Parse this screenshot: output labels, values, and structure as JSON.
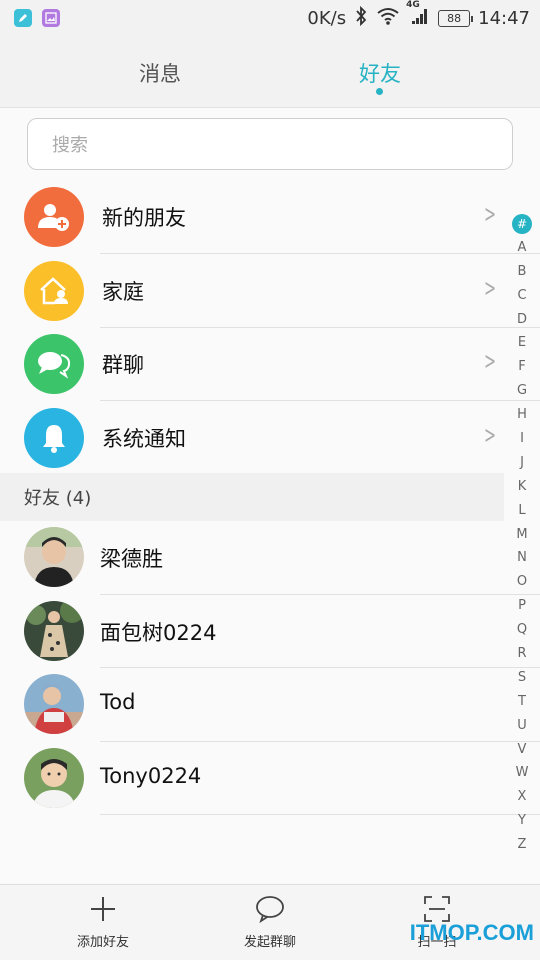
{
  "status_bar": {
    "speed": "0K/s",
    "network": "4G",
    "battery": "88",
    "time": "14:47",
    "icons": [
      "note-app-icon",
      "gallery-app-icon",
      "bluetooth-icon",
      "wifi-icon",
      "signal-icon",
      "battery-icon"
    ]
  },
  "tabs": [
    {
      "label": "消息",
      "active": false
    },
    {
      "label": "好友",
      "active": true
    }
  ],
  "search": {
    "placeholder": "搜索"
  },
  "functions": [
    {
      "label": "新的朋友",
      "icon": "add-user-icon",
      "color": "#f26d3d"
    },
    {
      "label": "家庭",
      "icon": "home-icon",
      "color": "#fbbf2a"
    },
    {
      "label": "群聊",
      "icon": "chat-bubbles-icon",
      "color": "#3cc46a"
    },
    {
      "label": "系统通知",
      "icon": "bell-icon",
      "color": "#2ab4e2"
    }
  ],
  "section_header": "好友 (4)",
  "friends": [
    {
      "name": "梁德胜"
    },
    {
      "name": "面包树0224"
    },
    {
      "name": "Tod"
    },
    {
      "name": "Tony0224"
    }
  ],
  "index": [
    "#",
    "A",
    "B",
    "C",
    "D",
    "E",
    "F",
    "G",
    "H",
    "I",
    "J",
    "K",
    "L",
    "M",
    "N",
    "O",
    "P",
    "Q",
    "R",
    "S",
    "T",
    "U",
    "V",
    "W",
    "X",
    "Y",
    "Z"
  ],
  "bottom_bar": [
    {
      "label": "添加好友",
      "icon": "plus-icon"
    },
    {
      "label": "发起群聊",
      "icon": "chat-bubble-icon"
    },
    {
      "label": "扫一扫",
      "icon": "scan-icon"
    }
  ],
  "watermark": "ITMOP.COM",
  "colors": {
    "accent": "#26b3c4"
  }
}
